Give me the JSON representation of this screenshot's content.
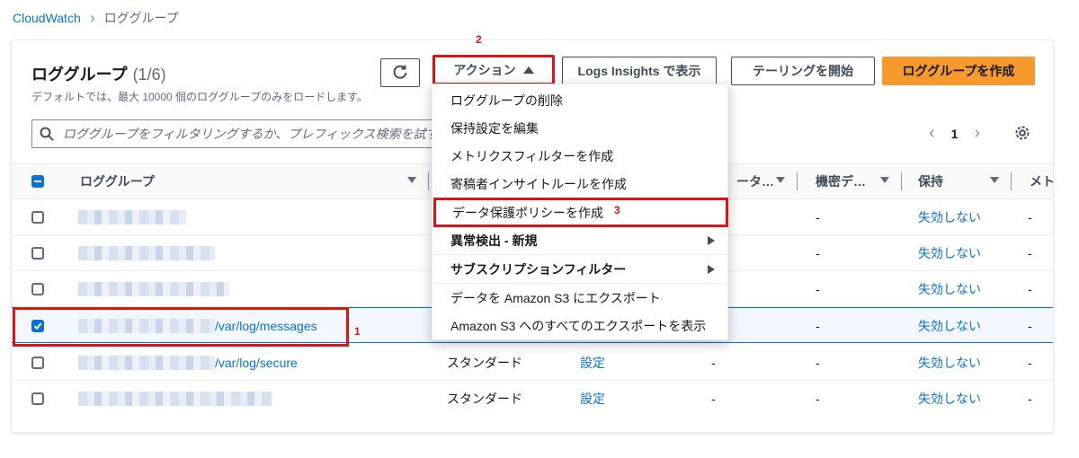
{
  "breadcrumb": {
    "root": "CloudWatch",
    "current": "ロググループ"
  },
  "header": {
    "title": "ロググループ",
    "count": "(1/6)",
    "description": "デフォルトでは、最大 10000 個のロググループのみをロードします。"
  },
  "toolbar": {
    "actions_label": "アクション",
    "insights_label": "Logs Insights で表示",
    "tail_label": "テーリングを開始",
    "create_label": "ロググループを作成"
  },
  "search": {
    "placeholder": "ロググループをフィルタリングするか、プレフィックス検索を試す"
  },
  "pagination": {
    "current_page": "1"
  },
  "table": {
    "columns": {
      "name": "ロググループ",
      "data_protection": "ータ…",
      "sensitive": "機密デ…",
      "retention": "保持",
      "metrics": "メト"
    },
    "rows": [
      {
        "checked": false,
        "name_suffix": "",
        "class": "",
        "subscription": "",
        "protection": "",
        "sensitive": "-",
        "retention": "失効しない",
        "metrics": "-"
      },
      {
        "checked": false,
        "name_suffix": "",
        "class": "",
        "subscription": "",
        "protection": "",
        "sensitive": "-",
        "retention": "失効しない",
        "metrics": "-"
      },
      {
        "checked": false,
        "name_suffix": "",
        "class": "",
        "subscription": "",
        "protection": "",
        "sensitive": "-",
        "retention": "失効しない",
        "metrics": "-"
      },
      {
        "checked": true,
        "name_suffix": "/var/log/messages",
        "class": "",
        "subscription": "",
        "protection": "",
        "sensitive": "-",
        "retention": "失効しない",
        "metrics": "-"
      },
      {
        "checked": false,
        "name_suffix": "/var/log/secure",
        "class": "スタンダード",
        "subscription": "設定",
        "protection": "-",
        "sensitive": "-",
        "retention": "失効しない",
        "metrics": "-"
      },
      {
        "checked": false,
        "name_suffix": "",
        "class": "スタンダード",
        "subscription": "設定",
        "protection": "-",
        "sensitive": "-",
        "retention": "失効しない",
        "metrics": "-"
      }
    ]
  },
  "actions_menu": [
    "ロググループの削除",
    "保持設定を編集",
    "メトリクスフィルターを作成",
    "寄稿者インサイトルールを作成",
    "データ保護ポリシーを作成",
    "異常検出 - 新規",
    "サブスクリプションフィルター",
    "データを Amazon S3 にエクスポート",
    "Amazon S3 へのすべてのエクスポートを表示"
  ],
  "annotations": {
    "step1": "1",
    "step2": "2",
    "step3": "3"
  },
  "colors": {
    "accent": "#0972d3",
    "primary_button": "#f79a2d",
    "annotation": "#d91515"
  }
}
